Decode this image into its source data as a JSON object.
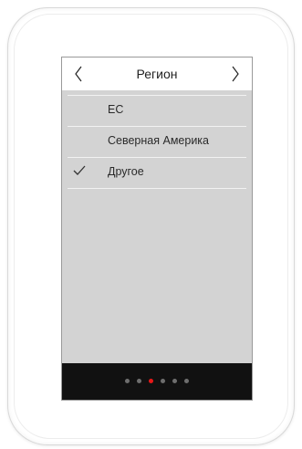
{
  "header": {
    "title": "Регион",
    "back_icon": "chevron-left-icon",
    "forward_icon": "chevron-right-icon"
  },
  "regions": [
    {
      "label": "ЕС",
      "selected": false
    },
    {
      "label": "Северная Америка",
      "selected": false
    },
    {
      "label": "Другое",
      "selected": true
    }
  ],
  "pager": {
    "count": 6,
    "active_index": 2,
    "active_color": "#e81818",
    "inactive_color": "#6e6e6e"
  },
  "colors": {
    "screen_background": "#d3d3d3",
    "header_background": "#ffffff",
    "footer_background": "#111111"
  }
}
